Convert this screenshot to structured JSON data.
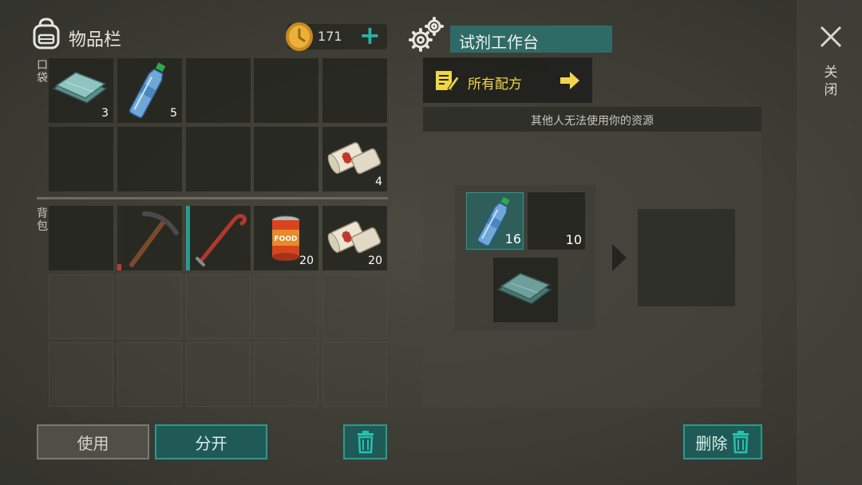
{
  "inventory": {
    "title": "物品栏",
    "coins": "171",
    "plus": "+",
    "pocket_label": "口袋",
    "backpack_label": "背包",
    "pocket_slots": [
      {
        "item": "cloth",
        "icon": "cloth-icon",
        "count": "3"
      },
      {
        "item": "water-bottle",
        "icon": "water-bottle-icon",
        "count": "5"
      },
      {
        "item": "",
        "count": ""
      },
      {
        "item": "",
        "count": ""
      },
      {
        "item": "",
        "count": ""
      },
      {
        "item": "",
        "count": ""
      },
      {
        "item": "",
        "count": ""
      },
      {
        "item": "",
        "count": ""
      },
      {
        "item": "",
        "count": ""
      },
      {
        "item": "bandage",
        "icon": "bandage-icon",
        "count": "4"
      }
    ],
    "backpack_slots": [
      {
        "item": "",
        "count": ""
      },
      {
        "item": "pickaxe",
        "icon": "pickaxe-icon",
        "count": "",
        "durability": 0.1,
        "durability_color": "#c0392b"
      },
      {
        "item": "crowbar",
        "icon": "crowbar-icon",
        "count": "",
        "durability": 1.0,
        "durability_color": "#2b9a90"
      },
      {
        "item": "canned-food",
        "icon": "canned-food-icon",
        "count": "20",
        "label": "FOOD"
      },
      {
        "item": "bandage",
        "icon": "bandage-icon",
        "count": "20"
      }
    ],
    "buttons": {
      "use": "使用",
      "split": "分开"
    }
  },
  "workbench": {
    "title": "试剂工作台",
    "recipes_label": "所有配方",
    "notice": "其他人无法使用你的资源",
    "ingredients": [
      {
        "item": "water-bottle",
        "icon": "water-bottle-icon",
        "have": "16",
        "need": "10"
      },
      {
        "item": "cloth",
        "icon": "cloth-icon"
      }
    ],
    "delete_label": "删除"
  },
  "close_label": "关闭",
  "colors": {
    "accent": "#2b9a90",
    "accent_dark": "#1f5a56",
    "recipes_text": "#f0d54a"
  }
}
